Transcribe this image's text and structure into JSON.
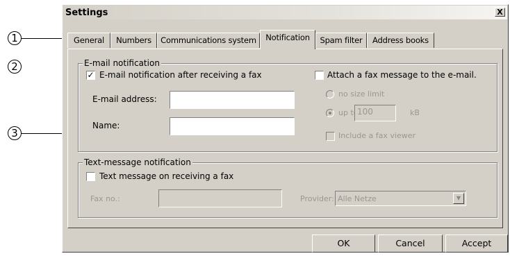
{
  "callouts": [
    "1",
    "2",
    "3"
  ],
  "dialog": {
    "title": "Settings",
    "close_symbol": "X"
  },
  "tabs": [
    {
      "label": "General",
      "active": false
    },
    {
      "label": "Numbers",
      "active": false
    },
    {
      "label": "Communications system",
      "active": false
    },
    {
      "label": "Notification",
      "active": true
    },
    {
      "label": "Spam filter",
      "active": false
    },
    {
      "label": "Address books",
      "active": false
    }
  ],
  "email_group": {
    "title": "E-mail notification",
    "after_fax_checkbox": {
      "label": "E-mail notification after receiving a fax",
      "checked": true
    },
    "email_address": {
      "label": "E-mail address:",
      "value": ""
    },
    "name": {
      "label": "Name:",
      "value": ""
    },
    "attach_checkbox": {
      "label": "Attach a fax message to the e-mail.",
      "checked": false
    },
    "no_size_limit": {
      "label": "no size limit",
      "selected": false,
      "enabled": false
    },
    "up_to": {
      "label": "up to",
      "value": "100",
      "unit": "kB",
      "selected": true,
      "enabled": false
    },
    "include_viewer": {
      "label": "Include a fax viewer",
      "checked": false,
      "enabled": false
    }
  },
  "sms_group": {
    "title": "Text-message notification",
    "sms_checkbox": {
      "label": "Text message on receiving a fax",
      "checked": false
    },
    "fax_no": {
      "label": "Fax no.:",
      "value": ""
    },
    "provider": {
      "label": "Provider:",
      "value": "Alle Netze"
    }
  },
  "buttons": {
    "ok": "OK",
    "cancel": "Cancel",
    "accept": "Accept"
  },
  "colors": {
    "dialog_bg": "#d4d0c8",
    "disabled_text": "#9a978f"
  }
}
